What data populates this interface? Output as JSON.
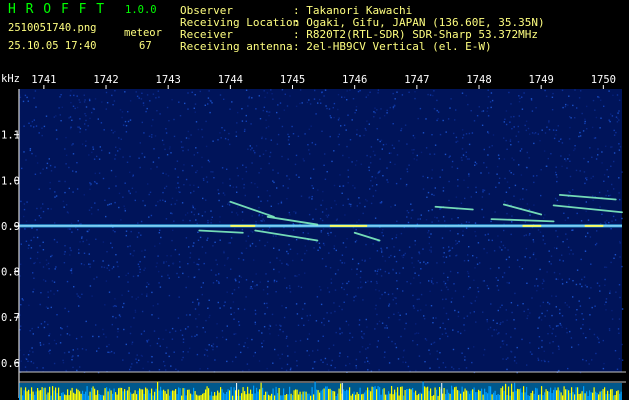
{
  "header": {
    "app_name": "H R O F F T",
    "version": "1.0.0",
    "filename": "2510051740.png",
    "datetime": "25.10.05 17:40",
    "count_label": "meteor",
    "count_value": "67",
    "observer_key": "Observer",
    "observer_value": ": Takanori Kawachi",
    "location_key": "Receiving Location",
    "location_value": ": Ogaki, Gifu, JAPAN (136.60E, 35.35N)",
    "receiver_key": "Receiver",
    "receiver_value": ": R820T2(RTL-SDR) SDR-Sharp 53.372MHz",
    "antenna_key": "Receiving antenna",
    "antenna_value": ": 2el-HB9CV Vertical (el. E-W)"
  },
  "colors": {
    "title": "#00ff00",
    "header_text": "#ffff80",
    "axis_text": "#ffffff",
    "background": "#000000",
    "noise_base": "#00145a",
    "carrier": "#40c8ff",
    "carrier_core": "#ffff60",
    "meteor": "#80f0c0",
    "power_bar": "#ffff00",
    "power_base": "#00a0ff"
  },
  "chart_data": {
    "type": "heatmap",
    "ylabel": "kHz",
    "x_ticks": [
      "1741",
      "1742",
      "1743",
      "1744",
      "1745",
      "1746",
      "1747",
      "1748",
      "1749",
      "1750"
    ],
    "xlim": [
      1740.6,
      1750.3
    ],
    "y_ticks": [
      "1.1",
      "1.0",
      "0.9",
      "0.8",
      "0.7",
      "0.6"
    ],
    "ylim": [
      0.58,
      1.2
    ],
    "carrier_khz": 0.9,
    "meteor_echoes": [
      {
        "t_start": 1744.0,
        "f_start": 0.953,
        "t_end": 1744.7,
        "f_end": 0.92
      },
      {
        "t_start": 1744.6,
        "f_start": 0.92,
        "t_end": 1745.4,
        "f_end": 0.903
      },
      {
        "t_start": 1744.4,
        "f_start": 0.89,
        "t_end": 1745.4,
        "f_end": 0.868
      },
      {
        "t_start": 1743.5,
        "f_start": 0.89,
        "t_end": 1744.2,
        "f_end": 0.885
      },
      {
        "t_start": 1746.0,
        "f_start": 0.885,
        "t_end": 1746.4,
        "f_end": 0.868
      },
      {
        "t_start": 1747.3,
        "f_start": 0.942,
        "t_end": 1747.9,
        "f_end": 0.936
      },
      {
        "t_start": 1748.4,
        "f_start": 0.947,
        "t_end": 1749.0,
        "f_end": 0.925
      },
      {
        "t_start": 1749.2,
        "f_start": 0.945,
        "t_end": 1750.3,
        "f_end": 0.93
      },
      {
        "t_start": 1749.3,
        "f_start": 0.968,
        "t_end": 1750.2,
        "f_end": 0.958
      },
      {
        "t_start": 1748.2,
        "f_start": 0.915,
        "t_end": 1749.2,
        "f_end": 0.91
      }
    ],
    "grid": true
  }
}
